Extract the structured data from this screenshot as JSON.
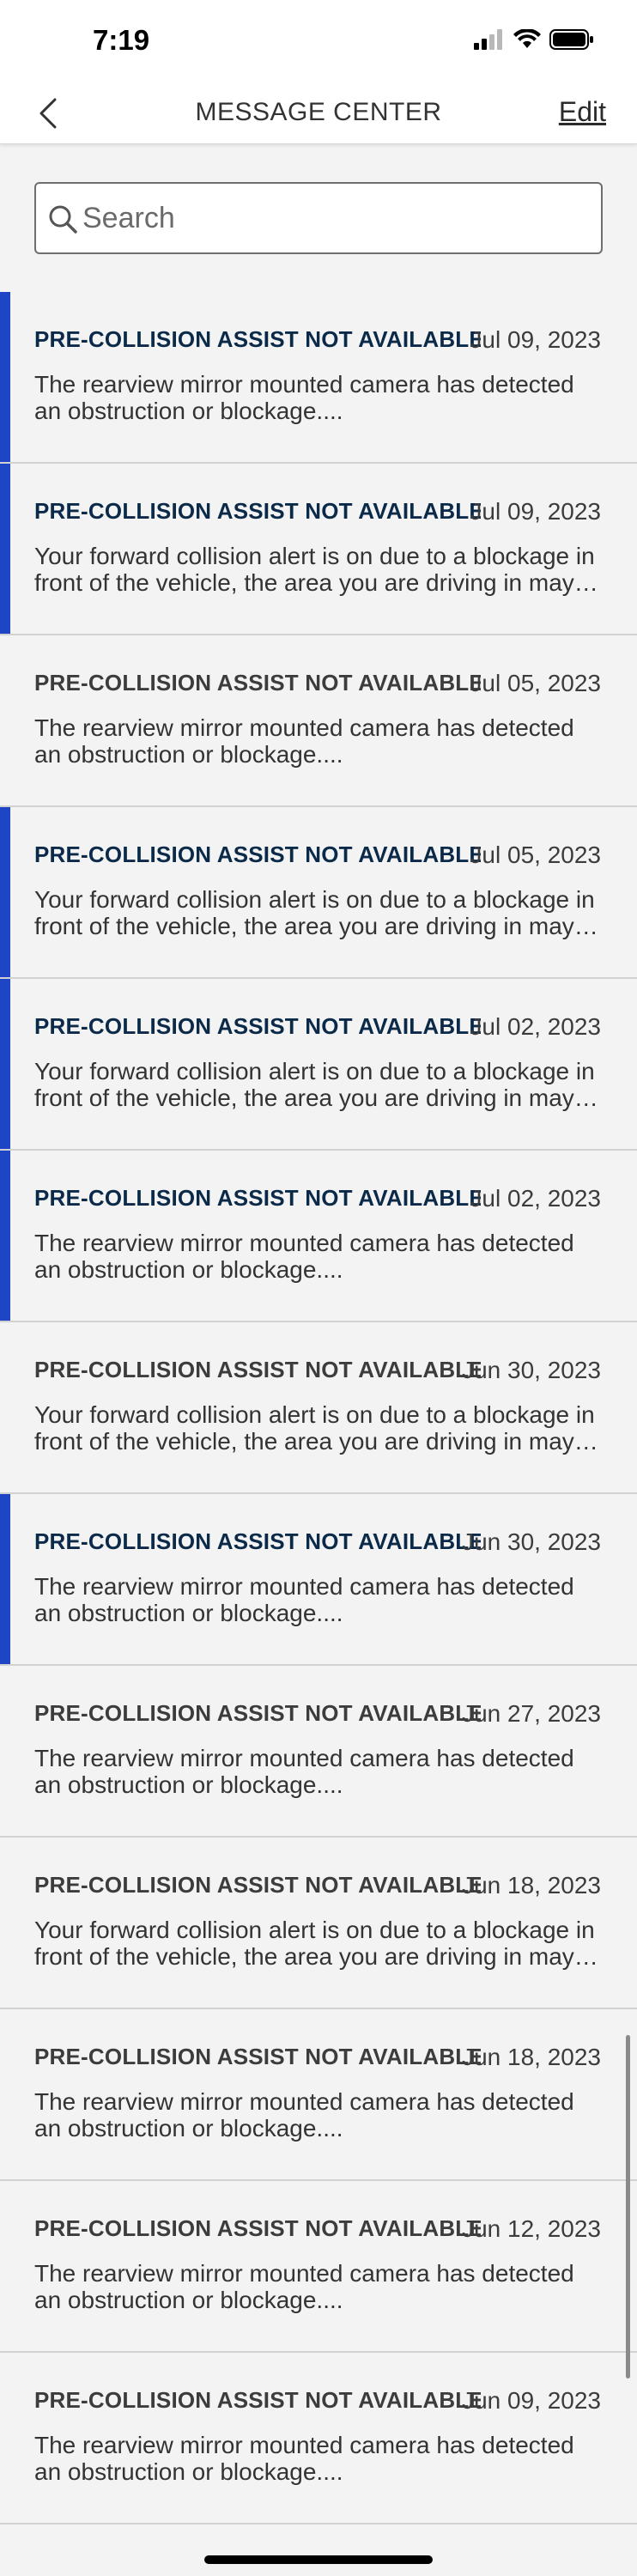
{
  "status_bar": {
    "time": "7:19"
  },
  "nav": {
    "title": "MESSAGE CENTER",
    "edit_label": "Edit"
  },
  "search": {
    "placeholder": "Search",
    "value": ""
  },
  "messages": [
    {
      "title": "PRE-COLLISION ASSIST NOT AVAILABLE",
      "date": "Jul 09, 2023",
      "body": "The rearview mirror mounted camera has detected an obstruction or blockage....",
      "unread": true
    },
    {
      "title": "PRE-COLLISION ASSIST NOT AVAILABLE",
      "date": "Jul 09, 2023",
      "body": "Your forward collision alert is on due to a blockage in front of the vehicle, the area you are driving in may be causing the issue....",
      "unread": true
    },
    {
      "title": "PRE-COLLISION ASSIST NOT AVAILABLE",
      "date": "Jul 05, 2023",
      "body": "The rearview mirror mounted camera has detected an obstruction or blockage....",
      "unread": false
    },
    {
      "title": "PRE-COLLISION ASSIST NOT AVAILABLE",
      "date": "Jul 05, 2023",
      "body": "Your forward collision alert is on due to a blockage in front of the vehicle, the area you are driving in may be causing the issue....",
      "unread": true
    },
    {
      "title": "PRE-COLLISION ASSIST NOT AVAILABLE",
      "date": "Jul 02, 2023",
      "body": "Your forward collision alert is on due to a blockage in front of the vehicle, the area you are driving in may be causing the issue....",
      "unread": true
    },
    {
      "title": "PRE-COLLISION ASSIST NOT AVAILABLE",
      "date": "Jul 02, 2023",
      "body": "The rearview mirror mounted camera has detected an obstruction or blockage....",
      "unread": true
    },
    {
      "title": "PRE-COLLISION ASSIST NOT AVAILABLE",
      "date": "Jun 30, 2023",
      "body": "Your forward collision alert is on due to a blockage in front of the vehicle, the area you are driving in may be causing the issue....",
      "unread": false
    },
    {
      "title": "PRE-COLLISION ASSIST NOT AVAILABLE",
      "date": "Jun 30, 2023",
      "body": "The rearview mirror mounted camera has detected an obstruction or blockage....",
      "unread": true
    },
    {
      "title": "PRE-COLLISION ASSIST NOT AVAILABLE",
      "date": "Jun 27, 2023",
      "body": "The rearview mirror mounted camera has detected an obstruction or blockage....",
      "unread": false
    },
    {
      "title": "PRE-COLLISION ASSIST NOT AVAILABLE",
      "date": "Jun 18, 2023",
      "body": "Your forward collision alert is on due to a blockage in front of the vehicle, the area you are driving in may be causing the issue....",
      "unread": false
    },
    {
      "title": "PRE-COLLISION ASSIST NOT AVAILABLE",
      "date": "Jun 18, 2023",
      "body": "The rearview mirror mounted camera has detected an obstruction or blockage....",
      "unread": false
    },
    {
      "title": "PRE-COLLISION ASSIST NOT AVAILABLE",
      "date": "Jun 12, 2023",
      "body": "The rearview mirror mounted camera has detected an obstruction or blockage....",
      "unread": false
    },
    {
      "title": "PRE-COLLISION ASSIST NOT AVAILABLE",
      "date": "Jun 09, 2023",
      "body": "The rearview mirror mounted camera has detected an obstruction or blockage....",
      "unread": false
    }
  ],
  "colors": {
    "unread_accent": "#1f45c7",
    "background": "#f3f3f3"
  },
  "icons": {
    "back": "chevron-left-icon",
    "search": "search-icon",
    "signal": "cellular-signal-icon",
    "wifi": "wifi-icon",
    "battery": "battery-icon"
  }
}
